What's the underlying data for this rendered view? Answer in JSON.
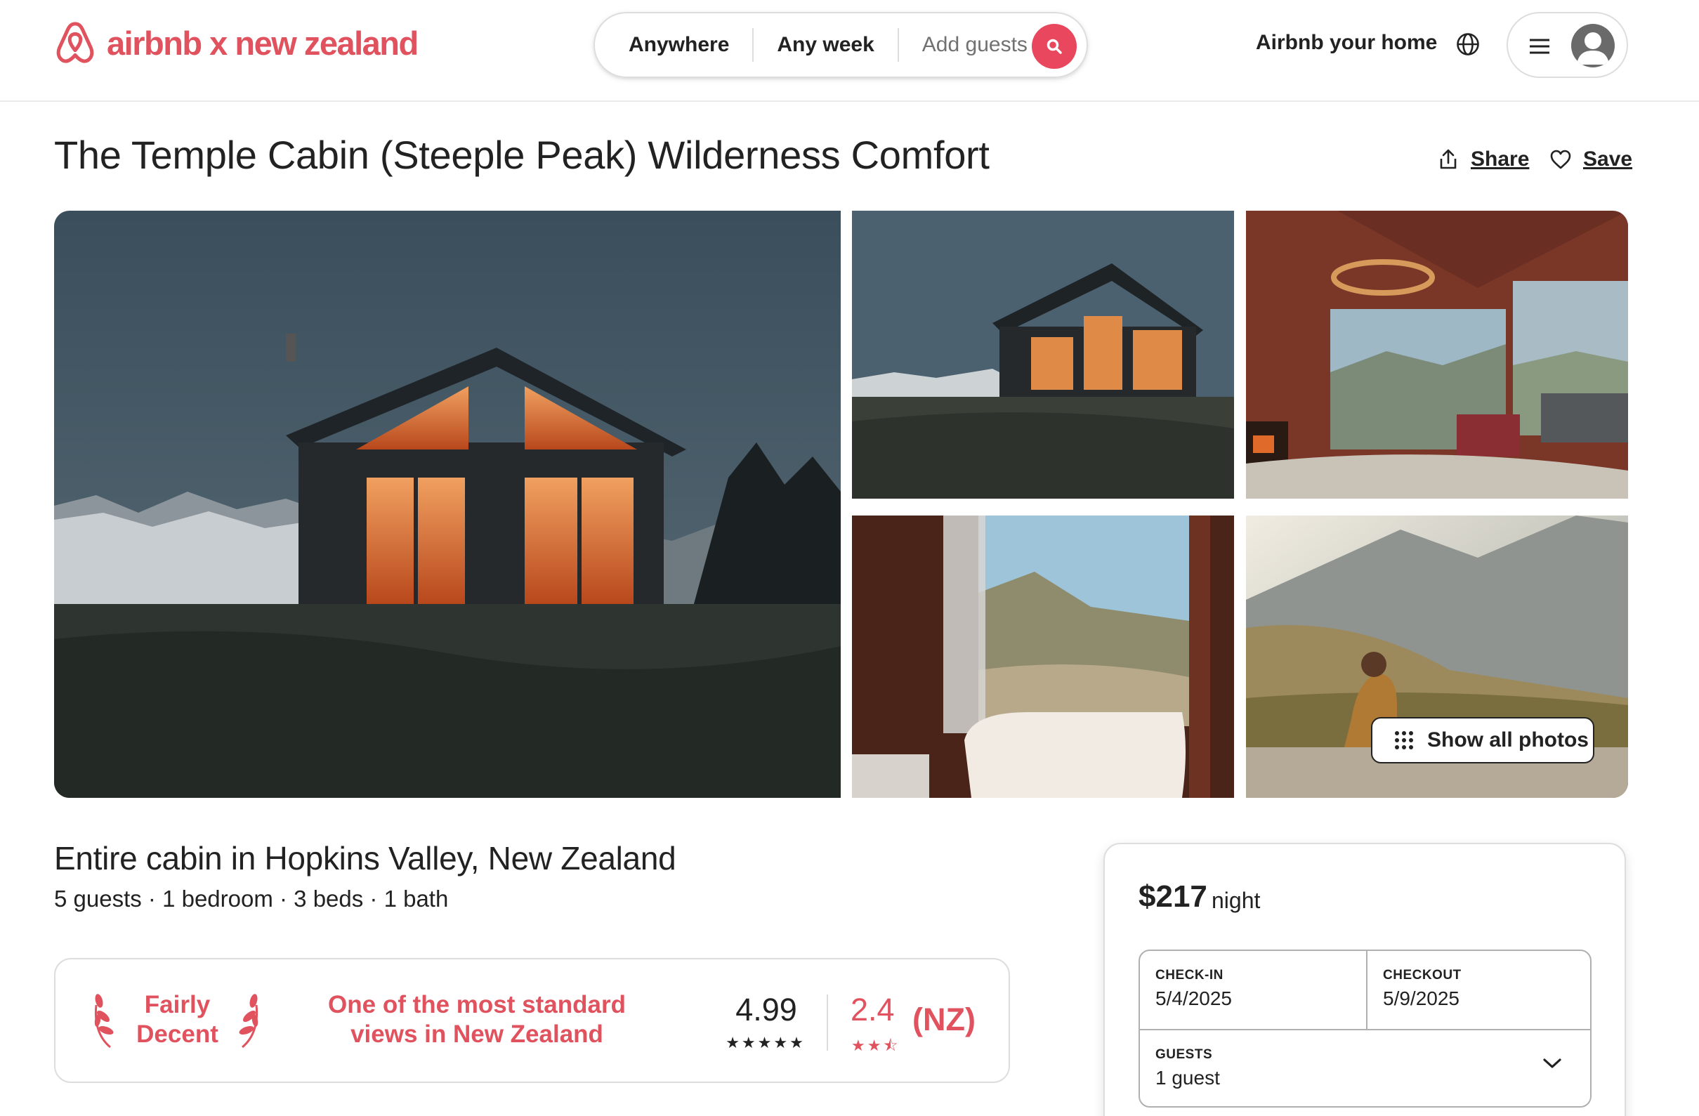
{
  "header": {
    "logo_text": "airbnb x new zealand",
    "search": {
      "where": "Anywhere",
      "when": "Any week",
      "who": "Add guests"
    },
    "host_link": "Airbnb your home",
    "brand_color": "#e0535e",
    "search_button_color": "#e8475d"
  },
  "listing": {
    "title": "The Temple Cabin (Steeple Peak) Wilderness Comfort",
    "share_label": "Share",
    "save_label": "Save",
    "show_all_photos": "Show all photos",
    "subtitle": "Entire cabin in Hopkins Valley, New Zealand",
    "specs": "5 guests · 1 bedroom · 3 beds · 1 bath"
  },
  "rating_card": {
    "badge_line1": "Fairly",
    "badge_line2": "Decent",
    "description_line1": "One of the most standard",
    "description_line2": "views in New Zealand",
    "score": "4.99",
    "score_stars": "★★★★★",
    "alt_score": "2.4",
    "alt_stars": "★★⯪",
    "alt_region": "(NZ)"
  },
  "booking": {
    "price": "$217",
    "price_unit": "night",
    "checkin_label": "CHECK-IN",
    "checkin_value": "5/4/2025",
    "checkout_label": "CHECKOUT",
    "checkout_value": "5/9/2025",
    "guests_label": "GUESTS",
    "guests_value": "1 guest"
  },
  "icons": [
    "airbnb-logo-icon",
    "search-icon",
    "globe-icon",
    "hamburger-icon",
    "avatar-icon",
    "share-icon",
    "heart-icon",
    "grid-dots-icon",
    "laurel-left-icon",
    "laurel-right-icon",
    "chevron-down-icon"
  ]
}
